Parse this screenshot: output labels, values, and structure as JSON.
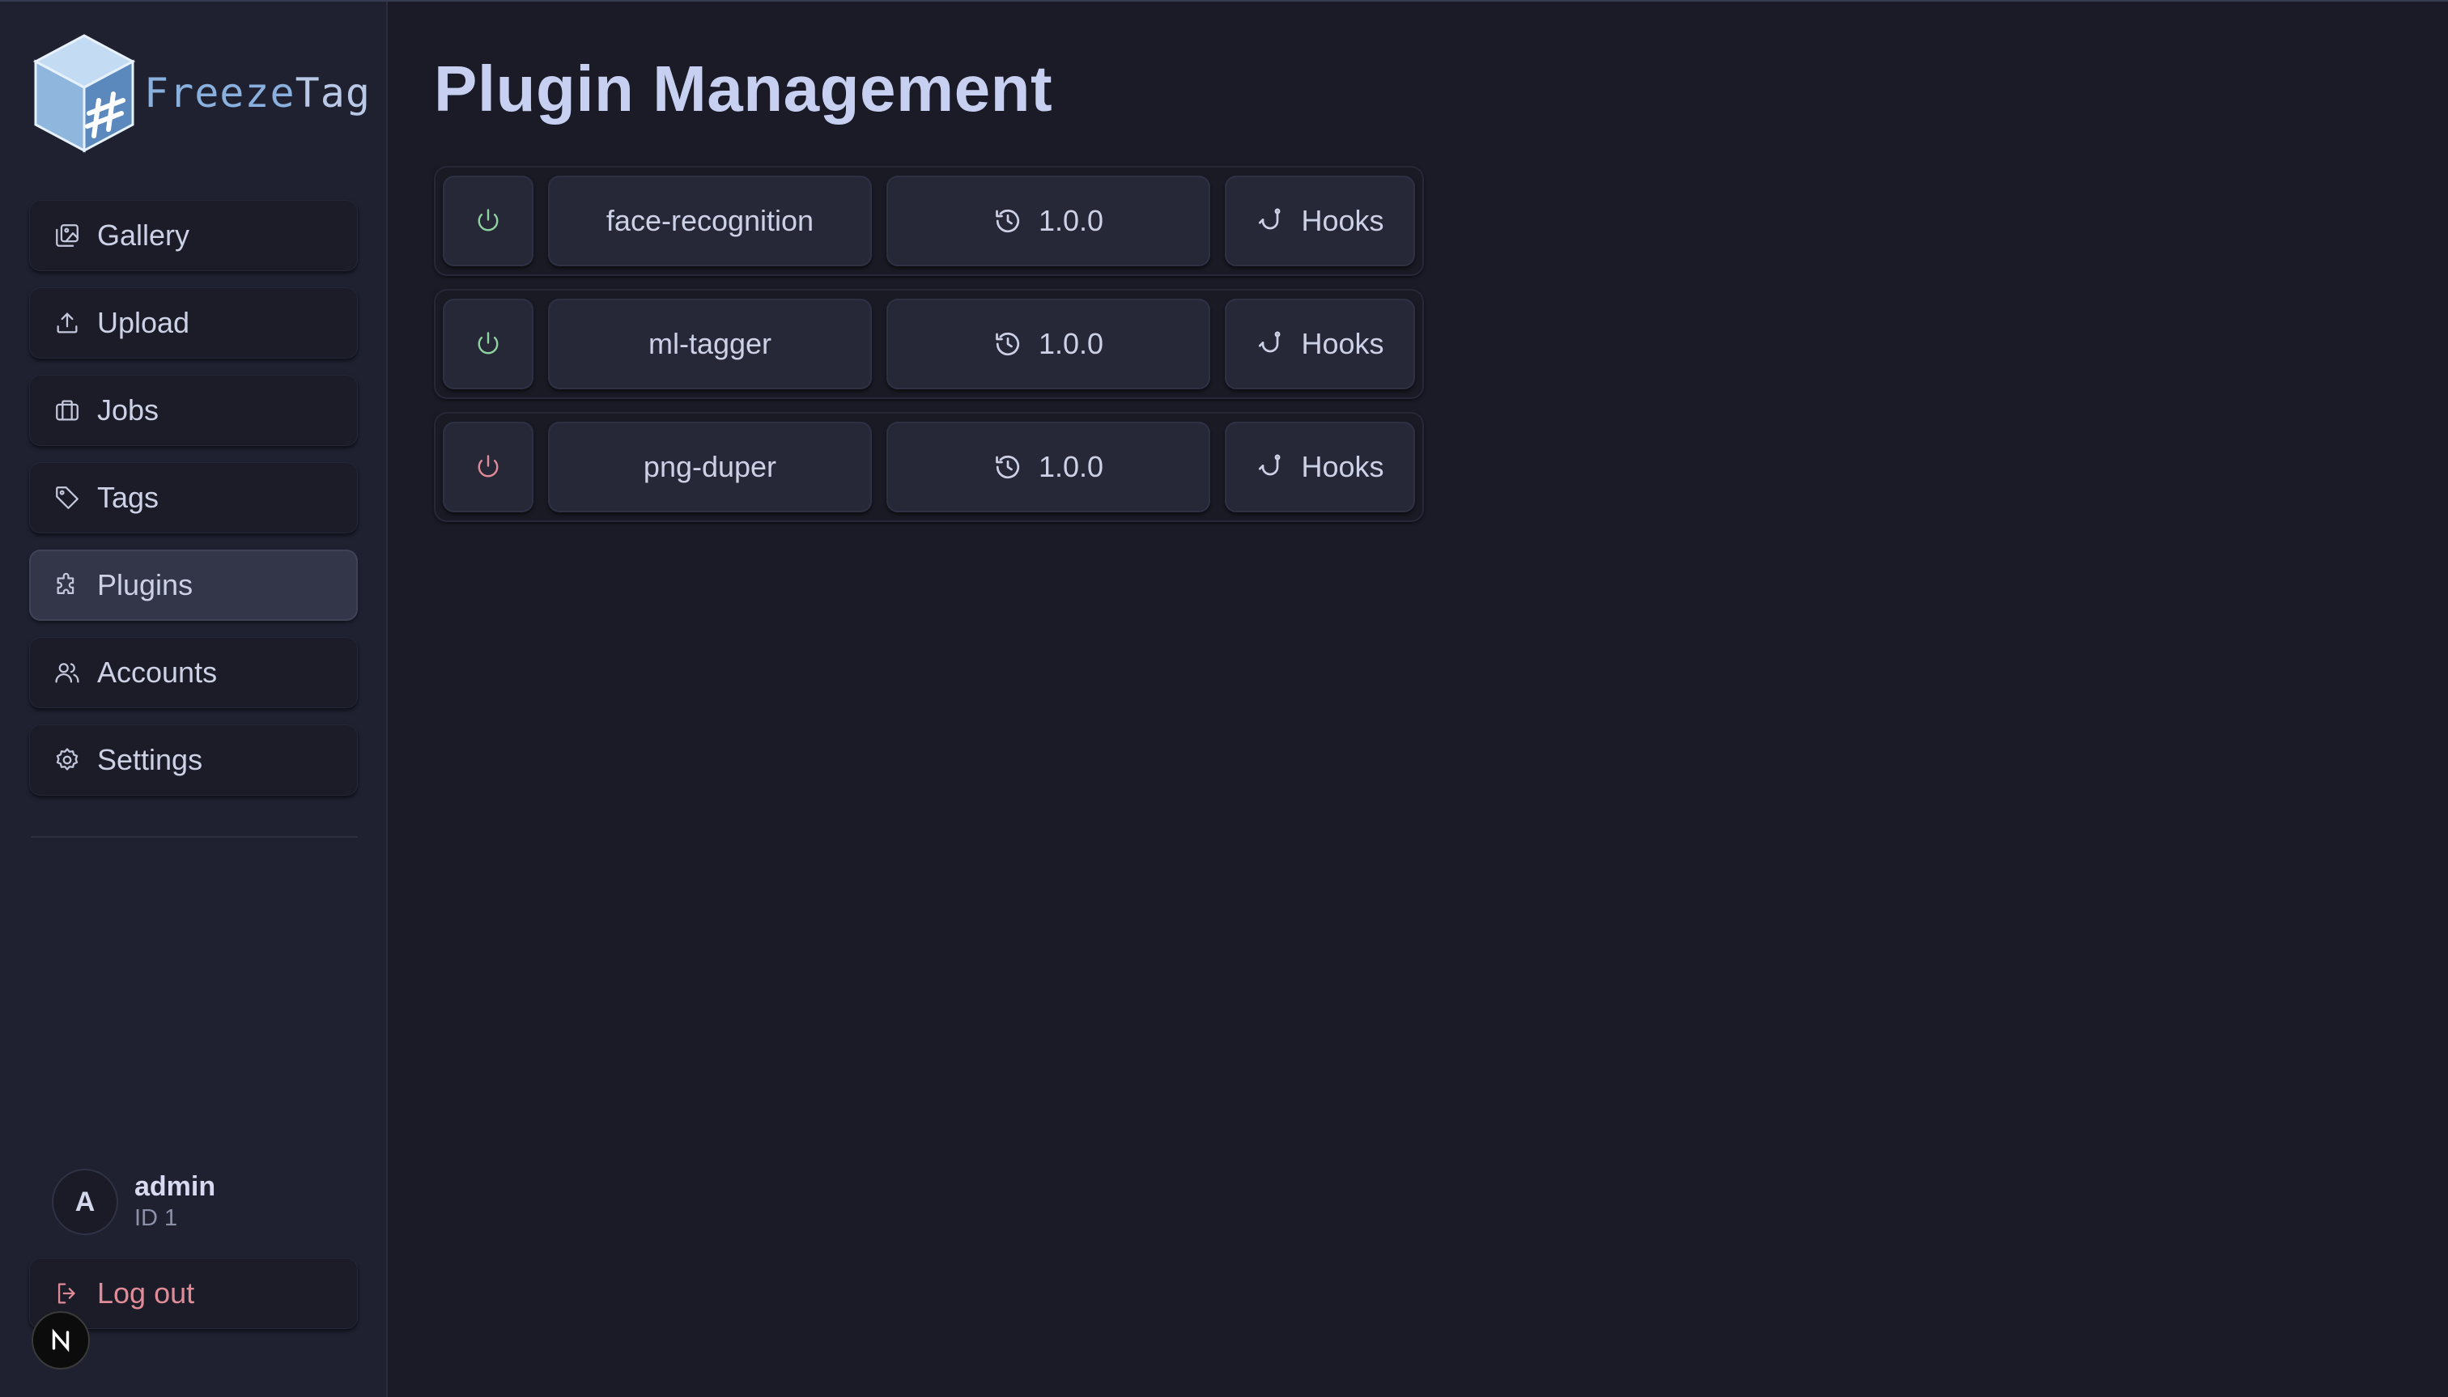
{
  "app": {
    "brand_freeze": "Freeze",
    "brand_tag": "Tag"
  },
  "colors": {
    "background": "#1b1b27",
    "sidebar": "#1f2131",
    "enabled": "#8dd3a0",
    "disabled": "#e08b98",
    "text": "#cdd1e6",
    "title": "#c8d0f2"
  },
  "sidebar": {
    "items": [
      {
        "label": "Gallery",
        "icon": "gallery-icon",
        "active": false
      },
      {
        "label": "Upload",
        "icon": "upload-icon",
        "active": false
      },
      {
        "label": "Jobs",
        "icon": "briefcase-icon",
        "active": false
      },
      {
        "label": "Tags",
        "icon": "tag-icon",
        "active": false
      },
      {
        "label": "Plugins",
        "icon": "puzzle-icon",
        "active": true
      },
      {
        "label": "Accounts",
        "icon": "users-icon",
        "active": false
      },
      {
        "label": "Settings",
        "icon": "gear-icon",
        "active": false
      }
    ],
    "user": {
      "avatar_initial": "A",
      "name": "admin",
      "id_label": "ID 1"
    },
    "logout_label": "Log out"
  },
  "main": {
    "title": "Plugin Management",
    "plugins": [
      {
        "name": "face-recognition",
        "version": "1.0.0",
        "enabled": true,
        "hooks_label": "Hooks"
      },
      {
        "name": "ml-tagger",
        "version": "1.0.0",
        "enabled": true,
        "hooks_label": "Hooks"
      },
      {
        "name": "png-duper",
        "version": "1.0.0",
        "enabled": false,
        "hooks_label": "Hooks"
      }
    ]
  }
}
